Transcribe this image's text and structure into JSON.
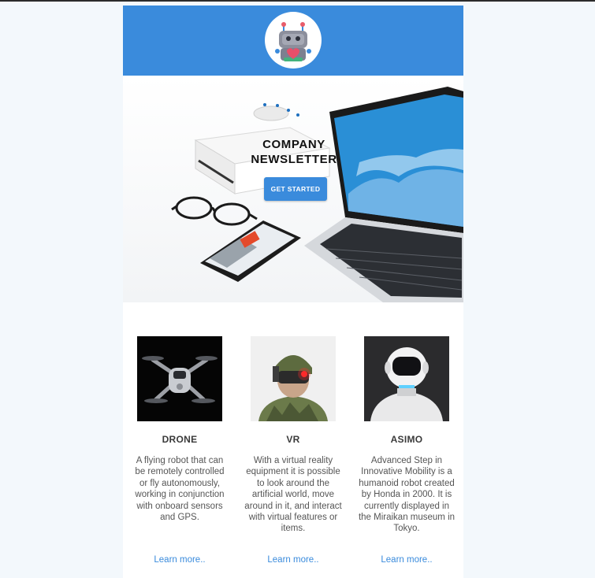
{
  "header": {
    "logo_icon": "robot-heart-logo-icon",
    "brand_color": "#3a8bdc"
  },
  "hero": {
    "title_line1": "COMPANY",
    "title_line2": "NEWSLETTER",
    "cta_label": "GET STARTED"
  },
  "cards": [
    {
      "title": "DRONE",
      "text": "A flying robot that can be remotely controlled or fly autonomously, working in conjunction with onboard sensors and GPS.",
      "link": "Learn more.."
    },
    {
      "title": "VR",
      "text": "With a virtual reality equipment it is possible to look around the artificial world, move around in it, and interact with virtual features or items.",
      "link": "Learn more.."
    },
    {
      "title": "ASIMO",
      "text": "Advanced Step in Innovative Mobility is a humanoid robot created by Honda in 2000. It is currently displayed in the Miraikan museum in Tokyo.",
      "link": "Learn more.."
    }
  ]
}
